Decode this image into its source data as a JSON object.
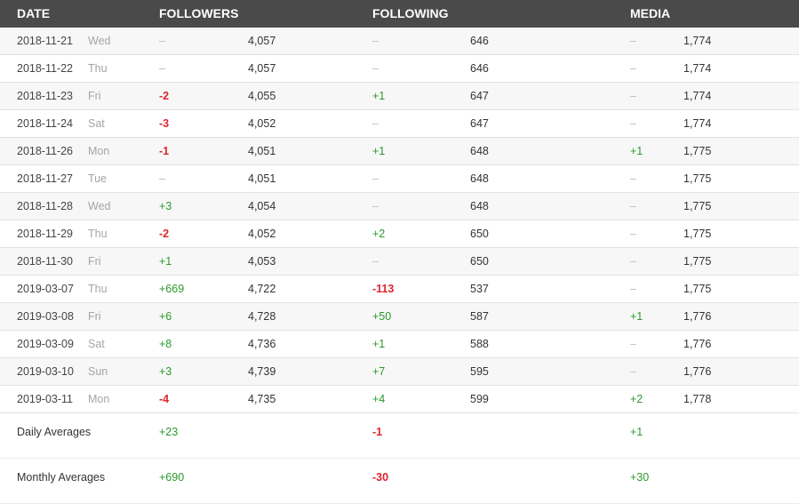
{
  "headers": {
    "date": "DATE",
    "followers": "FOLLOWERS",
    "following": "FOLLOWING",
    "media": "MEDIA"
  },
  "rows": [
    {
      "date": "2018-11-21",
      "day": "Wed",
      "followers_delta": "–",
      "followers_total": "4,057",
      "following_delta": "–",
      "following_total": "646",
      "media_delta": "–",
      "media_total": "1,774"
    },
    {
      "date": "2018-11-22",
      "day": "Thu",
      "followers_delta": "–",
      "followers_total": "4,057",
      "following_delta": "–",
      "following_total": "646",
      "media_delta": "–",
      "media_total": "1,774"
    },
    {
      "date": "2018-11-23",
      "day": "Fri",
      "followers_delta": "-2",
      "followers_total": "4,055",
      "following_delta": "+1",
      "following_total": "647",
      "media_delta": "–",
      "media_total": "1,774"
    },
    {
      "date": "2018-11-24",
      "day": "Sat",
      "followers_delta": "-3",
      "followers_total": "4,052",
      "following_delta": "–",
      "following_total": "647",
      "media_delta": "–",
      "media_total": "1,774"
    },
    {
      "date": "2018-11-26",
      "day": "Mon",
      "followers_delta": "-1",
      "followers_total": "4,051",
      "following_delta": "+1",
      "following_total": "648",
      "media_delta": "+1",
      "media_total": "1,775"
    },
    {
      "date": "2018-11-27",
      "day": "Tue",
      "followers_delta": "–",
      "followers_total": "4,051",
      "following_delta": "–",
      "following_total": "648",
      "media_delta": "–",
      "media_total": "1,775"
    },
    {
      "date": "2018-11-28",
      "day": "Wed",
      "followers_delta": "+3",
      "followers_total": "4,054",
      "following_delta": "–",
      "following_total": "648",
      "media_delta": "–",
      "media_total": "1,775"
    },
    {
      "date": "2018-11-29",
      "day": "Thu",
      "followers_delta": "-2",
      "followers_total": "4,052",
      "following_delta": "+2",
      "following_total": "650",
      "media_delta": "–",
      "media_total": "1,775"
    },
    {
      "date": "2018-11-30",
      "day": "Fri",
      "followers_delta": "+1",
      "followers_total": "4,053",
      "following_delta": "–",
      "following_total": "650",
      "media_delta": "–",
      "media_total": "1,775"
    },
    {
      "date": "2019-03-07",
      "day": "Thu",
      "followers_delta": "+669",
      "followers_total": "4,722",
      "following_delta": "-113",
      "following_total": "537",
      "media_delta": "–",
      "media_total": "1,775"
    },
    {
      "date": "2019-03-08",
      "day": "Fri",
      "followers_delta": "+6",
      "followers_total": "4,728",
      "following_delta": "+50",
      "following_total": "587",
      "media_delta": "+1",
      "media_total": "1,776"
    },
    {
      "date": "2019-03-09",
      "day": "Sat",
      "followers_delta": "+8",
      "followers_total": "4,736",
      "following_delta": "+1",
      "following_total": "588",
      "media_delta": "–",
      "media_total": "1,776"
    },
    {
      "date": "2019-03-10",
      "day": "Sun",
      "followers_delta": "+3",
      "followers_total": "4,739",
      "following_delta": "+7",
      "following_total": "595",
      "media_delta": "–",
      "media_total": "1,776"
    },
    {
      "date": "2019-03-11",
      "day": "Mon",
      "followers_delta": "-4",
      "followers_total": "4,735",
      "following_delta": "+4",
      "following_total": "599",
      "media_delta": "+2",
      "media_total": "1,778"
    }
  ],
  "averages": [
    {
      "label": "Daily Averages",
      "followers": "+23",
      "following": "-1",
      "media": "+1"
    },
    {
      "label": "Monthly Averages",
      "followers": "+690",
      "following": "-30",
      "media": "+30"
    }
  ],
  "colors": {
    "header_bg": "#4a4a4a",
    "positive": "#2b9a2b",
    "negative": "#e0242c",
    "neutral": "#bdbdbd"
  }
}
